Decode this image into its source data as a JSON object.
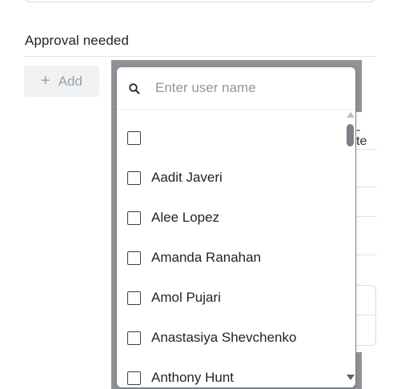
{
  "section": {
    "title": "Approval needed",
    "add_button_label": "Add",
    "add_button_icon": "plus-icon"
  },
  "background_fragments": [
    "-",
    "te"
  ],
  "user_picker": {
    "search_placeholder": "Enter user name",
    "search_value": "",
    "search_icon": "search-icon",
    "options": [
      {
        "label": "",
        "checked": false
      },
      {
        "label": "Aadit Javeri",
        "checked": false
      },
      {
        "label": "Alee Lopez",
        "checked": false
      },
      {
        "label": "Amanda Ranahan",
        "checked": false
      },
      {
        "label": "Amol Pujari",
        "checked": false
      },
      {
        "label": "Anastasiya Shevchenko",
        "checked": false
      },
      {
        "label": "Anthony Hunt",
        "checked": false
      }
    ]
  },
  "colors": {
    "text": "#1f2328",
    "placeholder": "#8d96a3",
    "button_bg": "#f1f2f4",
    "overlay": "#8f9296"
  }
}
